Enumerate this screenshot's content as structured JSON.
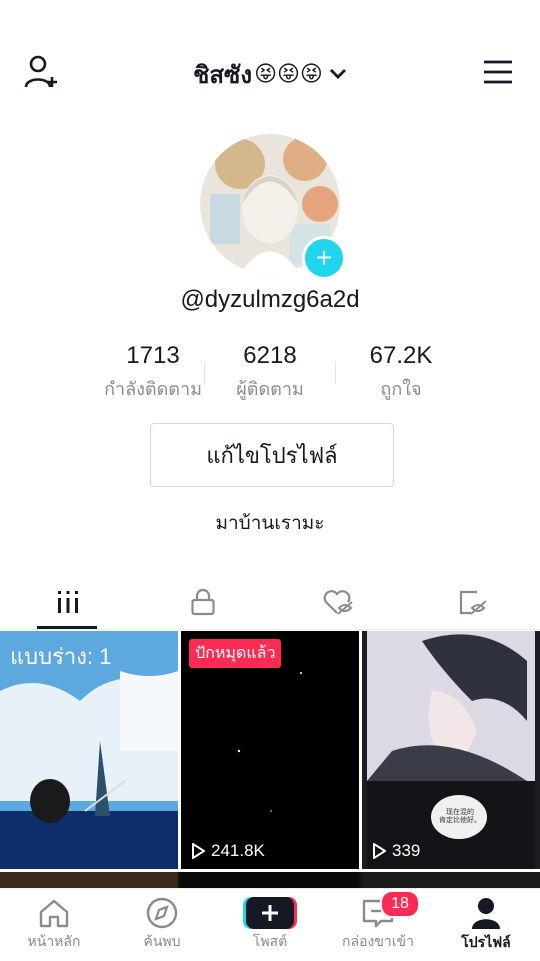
{
  "header": {
    "title": "ชิสซัง",
    "emojis": "😝😝😝"
  },
  "profile": {
    "username": "@dyzulmzg6a2d",
    "stats": [
      {
        "value": "1713",
        "label": "กำลังติดตาม"
      },
      {
        "value": "6218",
        "label": "ผู้ติดตาม"
      },
      {
        "value": "67.2K",
        "label": "ถูกใจ"
      }
    ],
    "edit_button_label": "แก้ไขโปรไฟล์",
    "bio": "มาบ้านเรามะ"
  },
  "tabs": [
    {
      "icon": "grid-icon",
      "active": true
    },
    {
      "icon": "lock-icon",
      "active": false
    },
    {
      "icon": "liked-hidden-icon",
      "active": false
    },
    {
      "icon": "saved-hidden-icon",
      "active": false
    }
  ],
  "videos": [
    {
      "label": "แบบร่าง: 1",
      "views": ""
    },
    {
      "badge": "ปักหมุดแล้ว",
      "views": "241.8K"
    },
    {
      "views": "339",
      "caption": "现在混的\n肯定比他好。"
    }
  ],
  "bottom_nav": [
    {
      "label": "หน้าหลัก",
      "icon": "home-icon"
    },
    {
      "label": "ค้นพบ",
      "icon": "compass-icon"
    },
    {
      "label": "โพสต์",
      "icon": "plus-icon"
    },
    {
      "label": "กล่องขาเข้า",
      "icon": "inbox-icon",
      "badge": "18"
    },
    {
      "label": "โปรไฟล์",
      "icon": "profile-icon",
      "active": true
    }
  ],
  "colors": {
    "accent_red": "#fe2c55",
    "accent_cyan": "#20d5ec",
    "text": "#161823",
    "muted": "#8a8b91"
  }
}
